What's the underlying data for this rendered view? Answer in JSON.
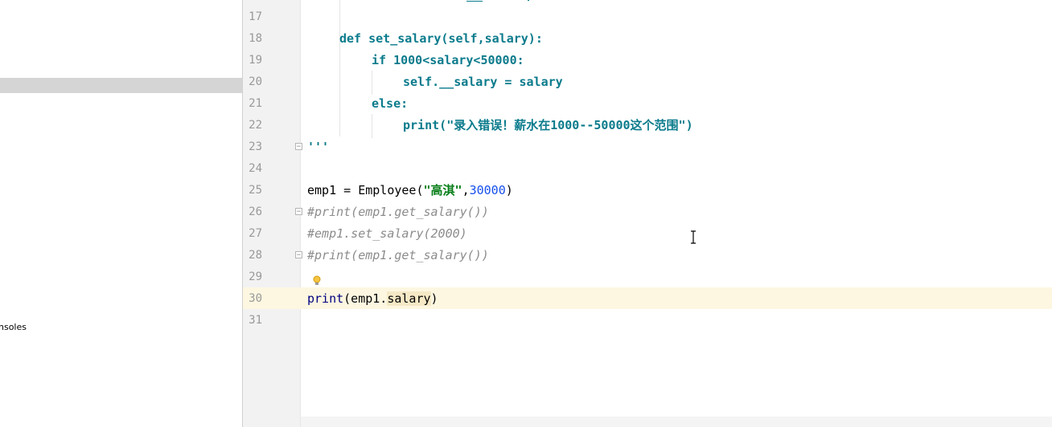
{
  "left_panel": {
    "consoles_label": "nsoles"
  },
  "editor": {
    "line_numbers": [
      "17",
      "18",
      "19",
      "20",
      "21",
      "22",
      "23",
      "24",
      "25",
      "26",
      "27",
      "28",
      "29",
      "30",
      "31"
    ],
    "lines": {
      "l18": {
        "kw": "def",
        "rest": " set_salary(self,salary):"
      },
      "l19": {
        "kw": "if",
        "rest": " 1000<salary<50000:"
      },
      "l20": "self.__salary = salary",
      "l21": "else:",
      "l22": {
        "fn": "print",
        "open": "(",
        "str": "\"录入错误！薪水在1000--50000这个范围\"",
        "close": ")"
      },
      "l23": "'''",
      "l25": {
        "pre": "emp1 = Employee(",
        "str": "\"高淇\"",
        "comma": ",",
        "num": "30000",
        "close": ")"
      },
      "l26": "#print(emp1.get_salary())",
      "l27": "#emp1.set_salary(2000)",
      "l28": "#print(emp1.get_salary())",
      "l30": {
        "fn": "print",
        "pre": "(emp1.",
        "hl": "salary",
        "close": ")"
      }
    },
    "current_line": "30"
  },
  "colors": {
    "keyword": "#0b7b8c",
    "comment": "#8c8c8c",
    "number": "#1750eb",
    "string": "#067d17",
    "current_line_bg": "#fdf7e1"
  },
  "icons": [
    "lightbulb-icon",
    "fold-icon",
    "text-cursor-icon"
  ]
}
